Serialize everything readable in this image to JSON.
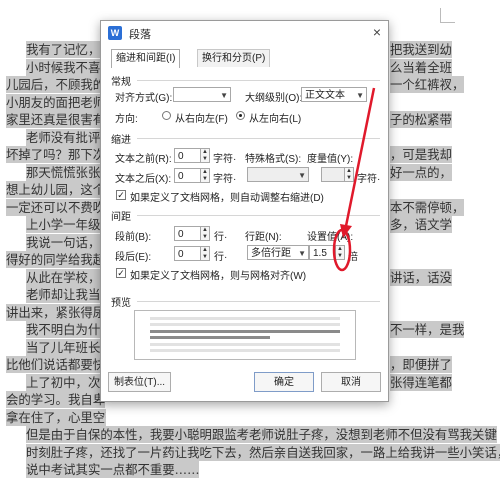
{
  "document": {
    "lines": [
      "我有了记忆，是",
      "小时候我不喜欢",
      "儿园后，不顾我的",
      "小朋友的面把老师的",
      "家里还真是很害有",
      "老师没有批评我",
      "坏掉了吗？那下次我",
      "那天慌慌张张的",
      "想上幼儿园，这个我",
      "一定还可以不费吹",
      "上小学一年级，",
      "我说一句话，那还给",
      "得好的同学给我起外",
      "从此在学校，我",
      "老师却让我当班",
      "讲出来，紧张得尿",
      "我不明白为什么",
      "当了儿年班长后",
      "比他们说话都要快",
      "上了初中，次次",
      "会的学习。我自卑",
      "拿在住了，心里空落",
      "但是由于自保的本性，我要小聪明跟监考老师说肚子疼，没想到老师不但没有骂我关键",
      "时刻肚子疼，还找了一片药让我吃下去，然后亲自送我回家，一路上给我讲一些小笑话，还",
      "说中考试其实一点都不重要……"
    ],
    "right_fragments": [
      "把我送到幼",
      "么当着全班",
      "一个红裤衩，",
      "",
      "子的松紧带",
      "",
      "，可是我却",
      "好一点的，",
      "",
      "本不需停顿，",
      "多，语文学",
      "",
      "",
      "讲话，话没",
      "",
      "",
      "不一样，是我",
      "",
      "，即便拼了",
      "张得连笔都"
    ]
  },
  "dialog": {
    "app_icon": "W",
    "title": "段落",
    "close": "×",
    "tabs": [
      "缩进和间距(I)",
      "换行和分页(P)"
    ],
    "general": {
      "section": "常规",
      "align_label": "对齐方式(G):",
      "align_value": "",
      "outline_label": "大纲级别(O):",
      "outline_value": "正文文本",
      "direction_label": "方向:",
      "rtl_label": "从右向左(F)",
      "ltr_label": "从左向右(L)",
      "ltr_selected": true
    },
    "indent": {
      "section": "缩进",
      "before_label": "文本之前(R):",
      "before_value": "0",
      "before_unit": "字符·",
      "special_label": "特殊格式(S):",
      "special_value": "",
      "measure_label": "度量值(Y):",
      "measure_value": "",
      "measure_unit": "字符·",
      "after_label": "文本之后(X):",
      "after_value": "0",
      "after_unit": "字符·",
      "grid_check": "如果定义了文档网格，则自动调整右缩进(D)"
    },
    "spacing": {
      "section": "间距",
      "before_label": "段前(B):",
      "before_value": "0",
      "before_unit": "行·",
      "line_label": "行距(N):",
      "line_value": "多倍行距",
      "setting_label": "设置值(A):",
      "setting_value": "1.5",
      "setting_unit": "倍",
      "after_label": "段后(E):",
      "after_value": "0",
      "after_unit": "行·",
      "grid_check": "如果定义了文档网格，则与网格对齐(W)"
    },
    "preview": {
      "section": "预览"
    },
    "buttons": {
      "tabs": "制表位(T)...",
      "ok": "确定",
      "cancel": "取消"
    }
  },
  "colors": {
    "highlight": "#c9c9c9",
    "annotation": "#e0192b",
    "accent": "#2b6fd6"
  }
}
